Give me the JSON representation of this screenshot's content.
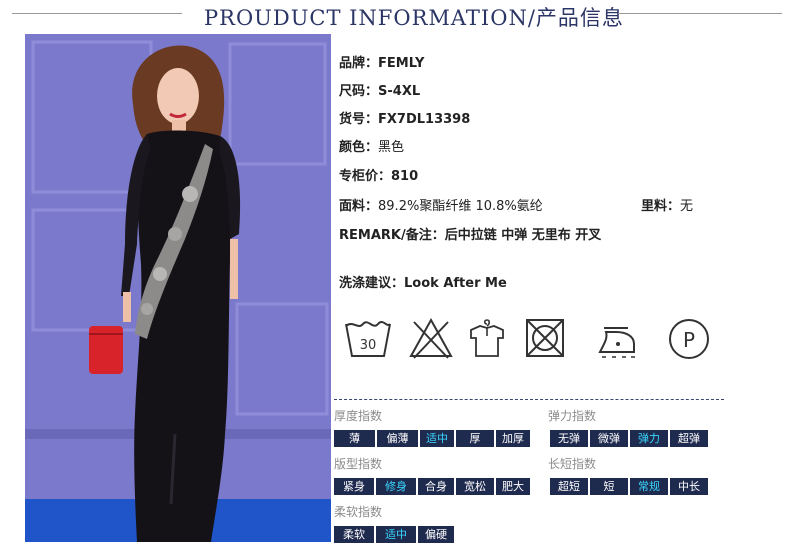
{
  "header": {
    "title": "PROUDUCT INFORMATION/产品信息"
  },
  "specs": {
    "brand_key": "品牌：",
    "brand": "FEMLY",
    "size_key": "尺码：",
    "size": "S-4XL",
    "sku_key": "货号：",
    "sku": "FX7DL13398",
    "color_key": "颜色：",
    "color": "黑色",
    "price_key": "专柜价：",
    "price": "810",
    "fabric_key": "面料：",
    "fabric": "89.2%聚酯纤维 10.8%氨纶",
    "lining_key": "里料：",
    "lining": "无",
    "remark_key": "REMARK/备注：",
    "remark": "后中拉链 中弹 无里布 开叉",
    "wash_key": "洗涤建议：",
    "wash": "Look After Me"
  },
  "care_icons": [
    {
      "icon": "wash-30-icon",
      "label": "30"
    },
    {
      "icon": "no-bleach-icon"
    },
    {
      "icon": "hang-dry-icon"
    },
    {
      "icon": "no-tumble-dry-icon"
    },
    {
      "icon": "iron-low-icon"
    },
    {
      "icon": "dry-clean-p-icon",
      "label": "P"
    }
  ],
  "indices": {
    "thickness": {
      "label": "厚度指数",
      "options": [
        "薄",
        "偏薄",
        "适中",
        "厚",
        "加厚"
      ],
      "selected": "适中"
    },
    "elasticity": {
      "label": "弹力指数",
      "options": [
        "无弹",
        "微弹",
        "弹力",
        "超弹"
      ],
      "selected": "弹力"
    },
    "fit": {
      "label": "版型指数",
      "options": [
        "紧身",
        "修身",
        "合身",
        "宽松",
        "肥大"
      ],
      "selected": "修身"
    },
    "length": {
      "label": "长短指数",
      "options": [
        "超短",
        "短",
        "常规",
        "中长"
      ],
      "selected": "常规"
    },
    "softness": {
      "label": "柔软指数",
      "options": [
        "柔软",
        "适中",
        "偏硬"
      ],
      "selected": "适中"
    }
  },
  "colors": {
    "title": "#2b3566",
    "cell_bg": "#1f2a4f",
    "cell_selected_text": "#39d8ff",
    "wall": "#7a78c9",
    "floor": "#1f55c8"
  }
}
